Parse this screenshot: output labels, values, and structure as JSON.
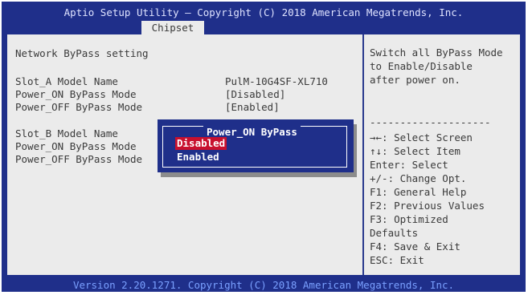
{
  "header": {
    "title": "Aptio Setup Utility – Copyright (C) 2018 American Megatrends, Inc.",
    "active_tab": "Chipset"
  },
  "settings": {
    "section_title": "Network ByPass setting",
    "slot_a": {
      "model_label": "Slot_A Model Name",
      "model_value": "PulM-10G4SF-XL710",
      "power_on_label": "Power_ON ByPass Mode",
      "power_on_value": "[Disabled]",
      "power_off_label": "Power_OFF ByPass Mode",
      "power_off_value": "[Enabled]"
    },
    "slot_b": {
      "model_label": "Slot_B Model Name",
      "power_on_label": "Power_ON ByPass Mode",
      "power_off_label": "Power_OFF ByPass Mode"
    }
  },
  "popup": {
    "title": "Power_ON ByPass",
    "options": [
      "Disabled",
      "Enabled"
    ],
    "selected": "Disabled"
  },
  "help": {
    "description_lines": [
      "Switch all ByPass Mode",
      "to Enable/Disable",
      "after power on."
    ],
    "separator": "--------------------",
    "keys": [
      "→←: Select Screen",
      "↑↓: Select Item",
      "Enter: Select",
      "+/-: Change Opt.",
      "F1: General Help",
      "F2: Previous Values",
      "F3: Optimized",
      "Defaults",
      "F4: Save & Exit",
      "ESC: Exit"
    ]
  },
  "footer": {
    "version": "Version 2.20.1271. Copyright (C) 2018 American Megatrends, Inc."
  },
  "colors": {
    "frame_blue": "#1f2f8a",
    "panel_gray": "#ebebeb",
    "selection_red": "#c8102e",
    "footer_text": "#7aa0ff"
  }
}
